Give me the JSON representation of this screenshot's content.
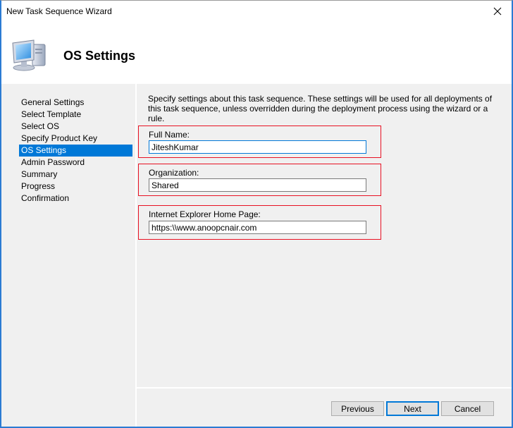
{
  "window": {
    "title": "New Task Sequence Wizard",
    "close_icon": "close-icon"
  },
  "header": {
    "title": "OS Settings",
    "icon": "computer-icon"
  },
  "nav": {
    "items": [
      {
        "label": "General Settings",
        "active": false
      },
      {
        "label": "Select Template",
        "active": false
      },
      {
        "label": "Select OS",
        "active": false
      },
      {
        "label": "Specify Product Key",
        "active": false
      },
      {
        "label": "OS Settings",
        "active": true
      },
      {
        "label": "Admin Password",
        "active": false
      },
      {
        "label": "Summary",
        "active": false
      },
      {
        "label": "Progress",
        "active": false
      },
      {
        "label": "Confirmation",
        "active": false
      }
    ]
  },
  "content": {
    "description": "Specify settings about this task sequence.  These settings will be used for all deployments of this task sequence, unless overridden during the deployment process using the wizard or a rule.",
    "fields": {
      "full_name": {
        "label": "Full Name:",
        "value": "JiteshKumar"
      },
      "organization": {
        "label": "Organization:",
        "value": "Shared"
      },
      "ie_home_page": {
        "label": "Internet Explorer Home Page:",
        "value": "https:\\\\www.anoopcnair.com"
      }
    }
  },
  "footer": {
    "previous": "Previous",
    "next": "Next",
    "cancel": "Cancel"
  },
  "colors": {
    "selection": "#0078d7",
    "highlight_border": "#e81123",
    "window_accent": "#2b7bd3"
  }
}
